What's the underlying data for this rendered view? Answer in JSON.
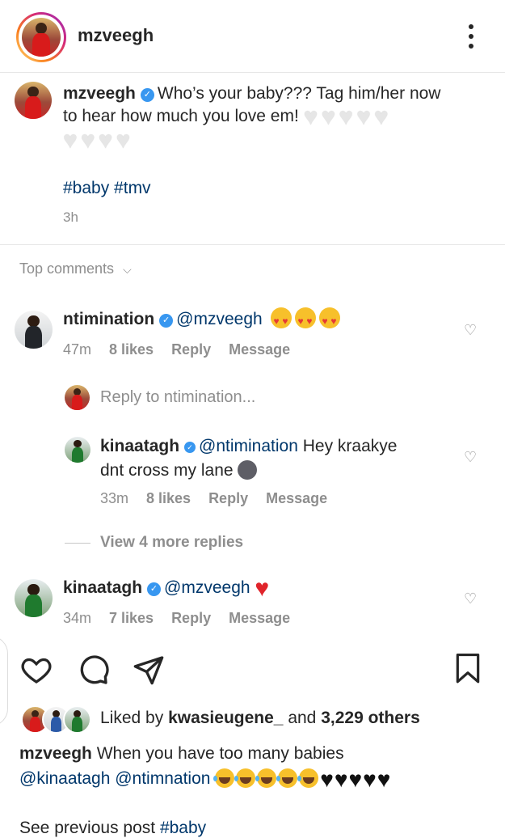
{
  "header": {
    "username": "mzveegh",
    "more_icon": "more-vertical-icon"
  },
  "caption": {
    "username": "mzveegh",
    "text_line1": "Who’s your baby??? Tag him/her now",
    "text_line2": "to hear how much you love em!",
    "hashtags": "#baby #tmv",
    "time": "3h"
  },
  "comments_header": {
    "label": "Top comments"
  },
  "comments": [
    {
      "username": "ntimination",
      "mention": "@mzveegh",
      "time": "47m",
      "likes": "8 likes",
      "reply": "Reply",
      "message": "Message"
    },
    {
      "username": "kinaatagh",
      "mention": "@mzveegh",
      "time": "34m",
      "likes": "7 likes",
      "reply": "Reply",
      "message": "Message"
    }
  ],
  "reply_prompt": {
    "label": "Reply to ntimination..."
  },
  "reply": {
    "username": "kinaatagh",
    "mention": "@ntimination",
    "text_line1": "Hey kraakye",
    "text_line2": "dnt cross my lane",
    "time": "33m",
    "likes": "8 likes",
    "reply": "Reply",
    "message": "Message"
  },
  "view_more": {
    "label": "View 4 more replies"
  },
  "actions": {
    "like_icon": "heart-icon",
    "comment_icon": "comment-icon",
    "share_icon": "send-icon",
    "save_icon": "bookmark-icon"
  },
  "liked_by": {
    "prefix": "Liked by",
    "user": "kwasieugene_",
    "and": "and",
    "others": "3,229 others"
  },
  "next_caption": {
    "username": "mzveegh",
    "text": "When you have too many babies",
    "mentions": "@kinaatagh @ntimnation",
    "see_previous": "See previous post",
    "see_previous_tag": "#baby"
  },
  "colors": {
    "verified": "#3897f0",
    "link": "#00376b",
    "secondary": "#8e8e8e"
  }
}
